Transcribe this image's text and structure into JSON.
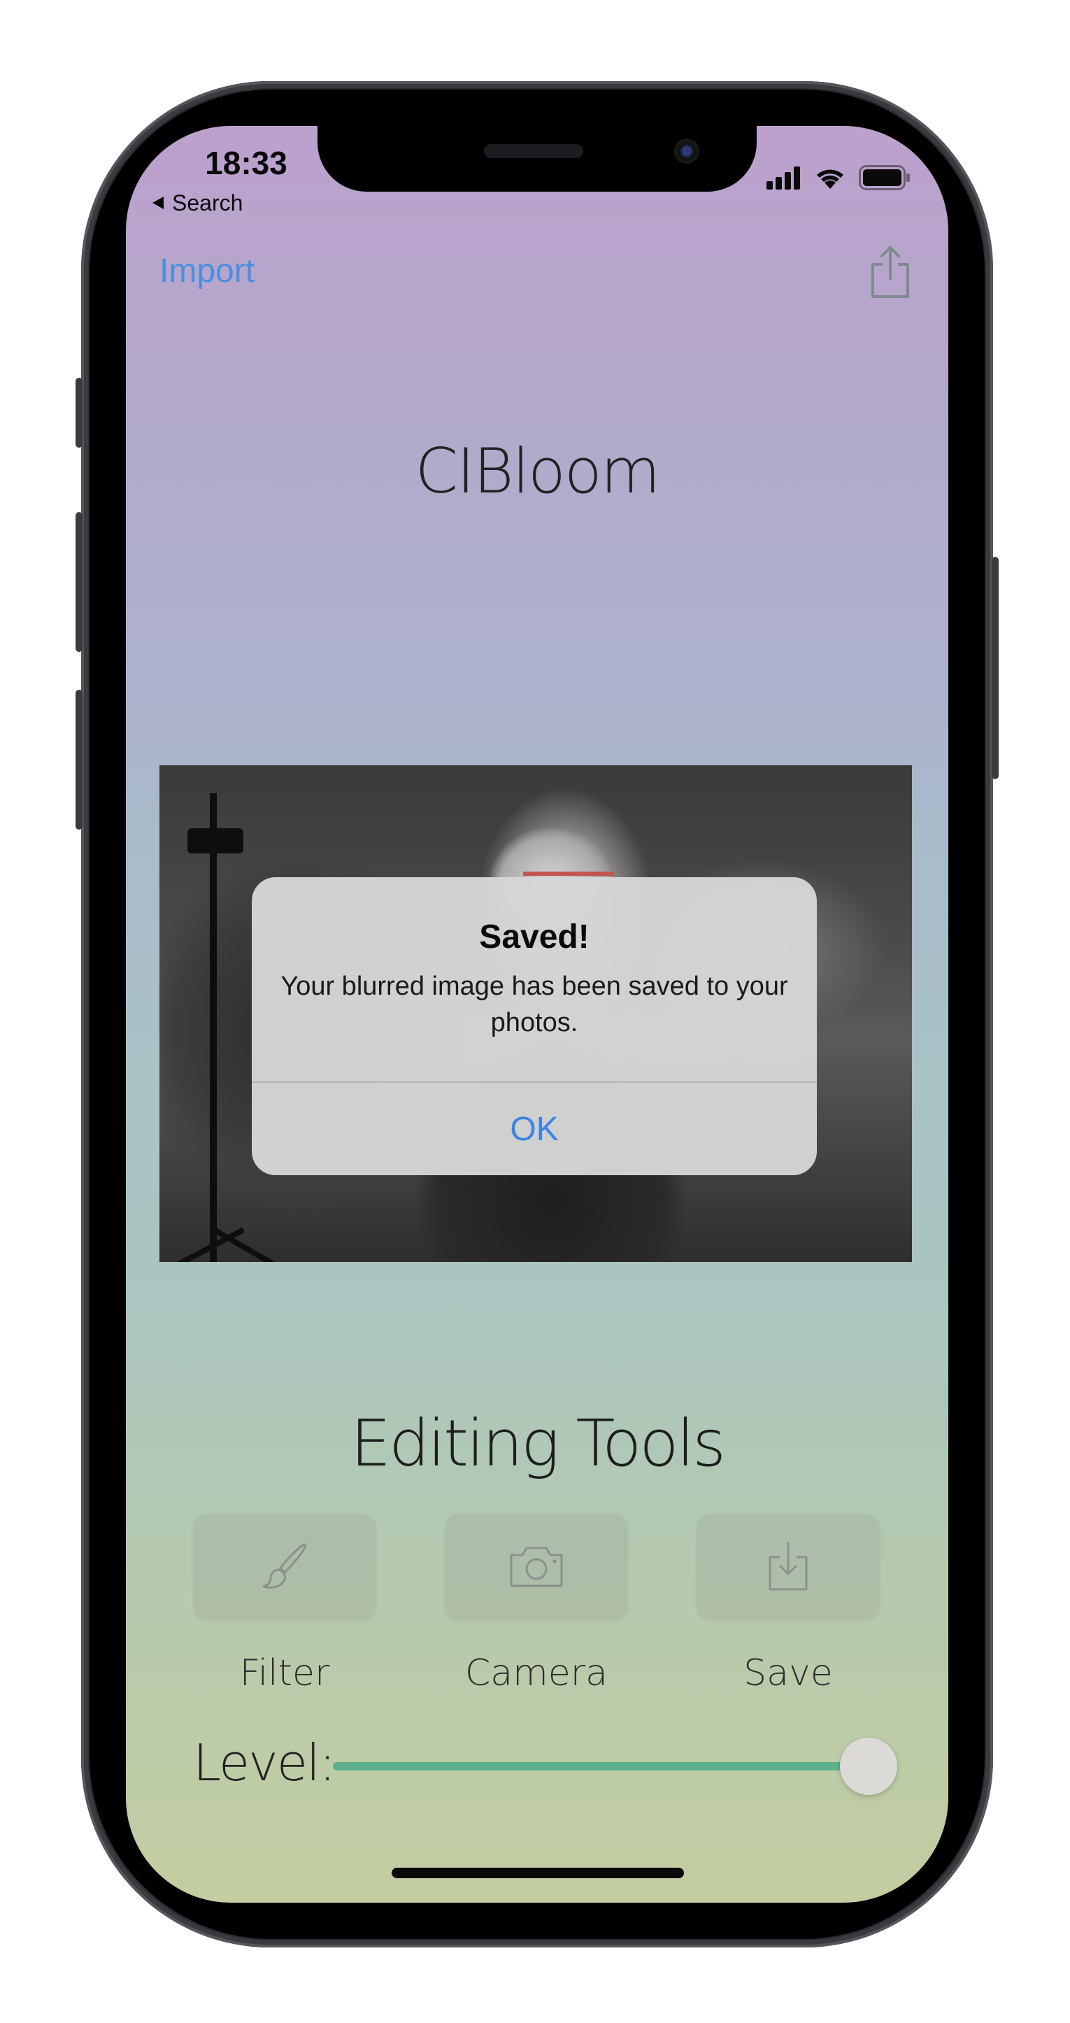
{
  "status_bar": {
    "time": "18:33",
    "back_label": "Search"
  },
  "nav": {
    "import_label": "Import",
    "share_icon": "share-icon"
  },
  "app": {
    "title": "CIBloom"
  },
  "alert": {
    "title": "Saved!",
    "message": "Your blurred image has been saved to your photos.",
    "ok_label": "OK"
  },
  "tools": {
    "title": "Editing Tools",
    "items": [
      {
        "label": "Filter",
        "icon": "paintbrush-icon"
      },
      {
        "label": "Camera",
        "icon": "camera-icon"
      },
      {
        "label": "Save",
        "icon": "download-icon"
      }
    ]
  },
  "level": {
    "label": "Level:",
    "value": 1.0
  },
  "colors": {
    "accent_blue": "#4a8fe0",
    "slider_green": "#5fb08a",
    "alert_ok_blue": "#3a84e6"
  }
}
